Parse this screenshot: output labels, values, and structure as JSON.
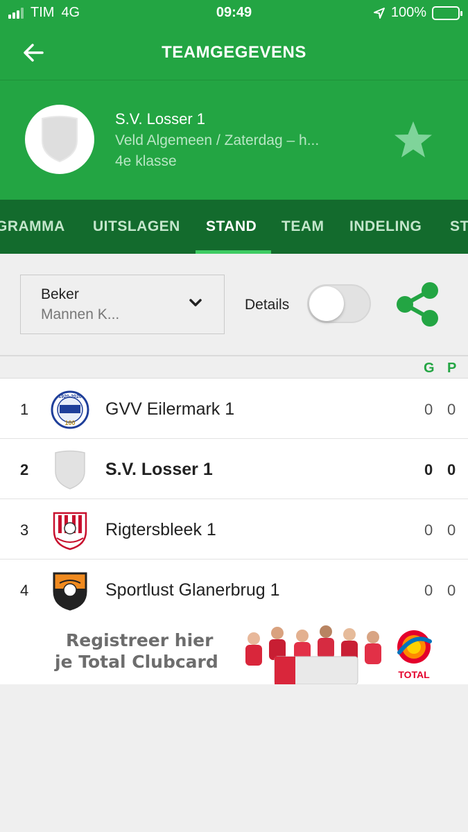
{
  "status_bar": {
    "carrier": "TIM",
    "network": "4G",
    "time": "09:49",
    "battery": "100%"
  },
  "nav": {
    "title": "TEAMGEGEVENS",
    "back_icon": "arrow-left-icon"
  },
  "team": {
    "name": "S.V. Losser 1",
    "subtitle": "Veld Algemeen / Zaterdag – h...",
    "class": "4e klasse",
    "favorite_icon": "star-icon"
  },
  "tabs": [
    {
      "label": "GRAMMA",
      "active": false
    },
    {
      "label": "UITSLAGEN",
      "active": false
    },
    {
      "label": "STAND",
      "active": true
    },
    {
      "label": "TEAM",
      "active": false
    },
    {
      "label": "INDELING",
      "active": false
    },
    {
      "label": "ST",
      "active": false
    }
  ],
  "filters": {
    "competition_title": "Beker",
    "competition_value": "Mannen K...",
    "details_label": "Details",
    "details_on": false
  },
  "table": {
    "columns": {
      "g": "G",
      "p": "P"
    },
    "rows": [
      {
        "pos": "1",
        "team": "GVV Eilermark 1",
        "g": "0",
        "p": "0",
        "highlight": false,
        "logo": "gvv-eilermark-logo"
      },
      {
        "pos": "2",
        "team": "S.V. Losser 1",
        "g": "0",
        "p": "0",
        "highlight": true,
        "logo": "placeholder-shield-logo"
      },
      {
        "pos": "3",
        "team": "Rigtersbleek 1",
        "g": "0",
        "p": "0",
        "highlight": false,
        "logo": "rigtersbleek-logo"
      },
      {
        "pos": "4",
        "team": "Sportlust Glanerbrug 1",
        "g": "0",
        "p": "0",
        "highlight": false,
        "logo": "sportlust-glanerbrug-logo"
      }
    ]
  },
  "ad": {
    "line1": "Registreer hier",
    "line2": "je Total Clubcard",
    "brand": "TOTAL"
  },
  "colors": {
    "primary": "#23a543",
    "tab_bar": "#136b2d",
    "tab_indicator": "#3ecb63",
    "background": "#efefef"
  }
}
